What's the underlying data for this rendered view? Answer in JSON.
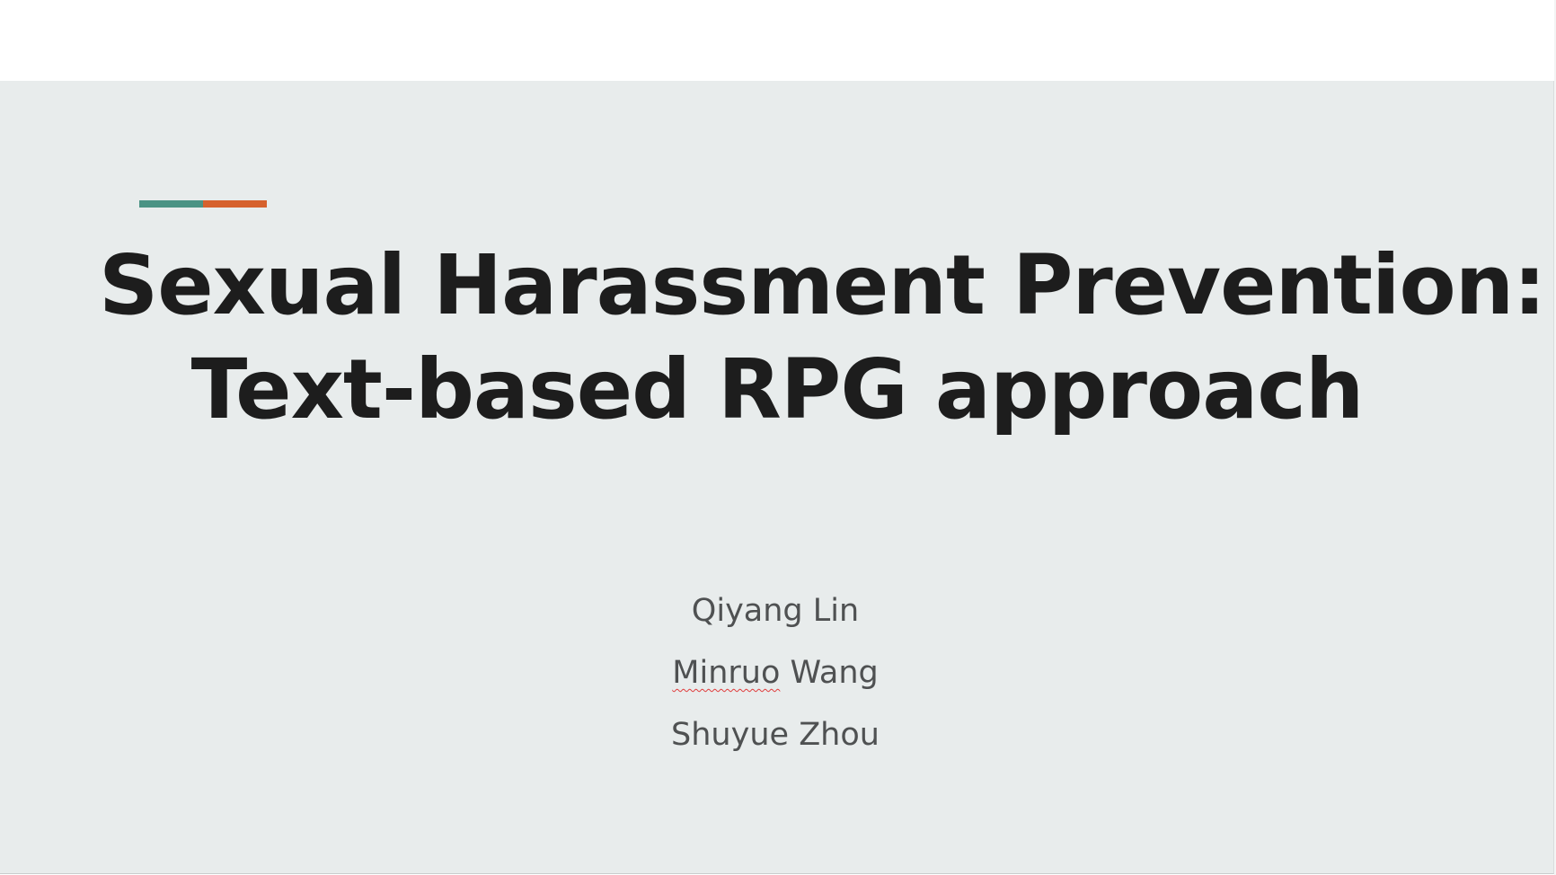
{
  "slide": {
    "title_line_1": "Sexual Harassment Prevention:",
    "title_line_2": "Text-based RPG approach",
    "authors": [
      {
        "first": "Qiyang",
        "last": "Lin",
        "spellcheck_flag": false
      },
      {
        "first": "Minruo",
        "last": "Wang",
        "spellcheck_flag": true
      },
      {
        "first": "Shuyue",
        "last": "Zhou",
        "spellcheck_flag": false
      }
    ]
  },
  "colors": {
    "slide_background": "#e8ecec",
    "title_text": "#1d1d1d",
    "author_text": "#4f5152",
    "accent_teal": "#4a9384",
    "accent_orange": "#d6612d",
    "spellcheck_underline": "#e03b3b"
  }
}
